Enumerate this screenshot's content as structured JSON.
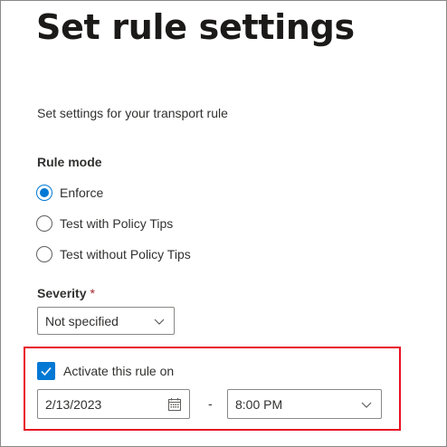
{
  "page": {
    "title": "Set rule settings",
    "description": "Set settings for your transport rule"
  },
  "rule_mode": {
    "label": "Rule mode",
    "options": [
      {
        "label": "Enforce",
        "selected": true
      },
      {
        "label": "Test with Policy Tips",
        "selected": false
      },
      {
        "label": "Test without Policy Tips",
        "selected": false
      }
    ]
  },
  "severity": {
    "label": "Severity",
    "required_marker": "*",
    "selected": "Not specified"
  },
  "activation": {
    "checkbox_label": "Activate this rule on",
    "checked": true,
    "date": "2/13/2023",
    "separator": "-",
    "time": "8:00 PM"
  },
  "colors": {
    "accent": "#0078d4",
    "highlight_border": "#e81123",
    "required": "#a4262c"
  },
  "icons": {
    "radio_selected": "radio-checked-icon",
    "checkbox": "checkmark-icon",
    "date": "calendar-icon",
    "dropdown": "chevron-down-icon"
  }
}
